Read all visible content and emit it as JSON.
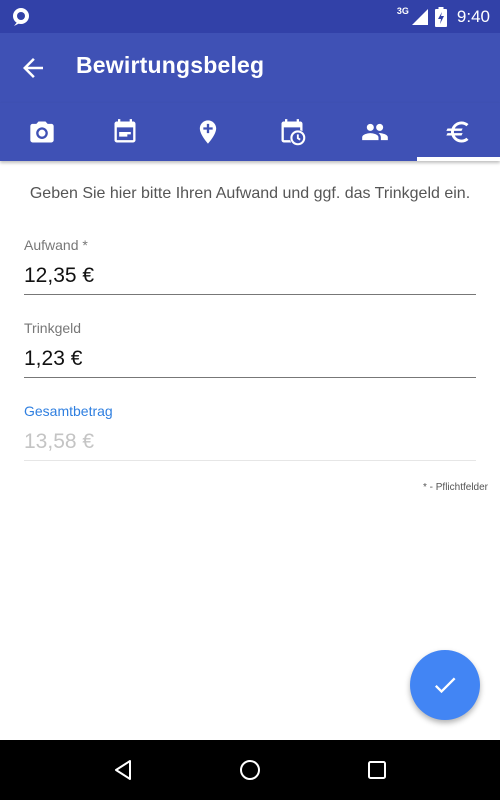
{
  "status_bar": {
    "network": "3G",
    "time": "9:40"
  },
  "app_bar": {
    "title": "Bewirtungsbeleg"
  },
  "tabs": [
    {
      "icon": "camera-icon"
    },
    {
      "icon": "calendar-icon"
    },
    {
      "icon": "add-location-icon"
    },
    {
      "icon": "schedule-calendar-icon"
    },
    {
      "icon": "people-icon"
    },
    {
      "icon": "euro-icon",
      "active": true
    }
  ],
  "form": {
    "instruction": "Geben Sie hier bitte Ihren Aufwand und ggf. das Trinkgeld ein.",
    "expense": {
      "label": "Aufwand *",
      "value": "12,35 €"
    },
    "tip": {
      "label": "Trinkgeld",
      "value": "1,23 €"
    },
    "total": {
      "label": "Gesamtbetrag",
      "value": "13,58 €"
    },
    "required_note": "* - Pflichtfelder"
  },
  "colors": {
    "primary": "#3f51b5",
    "primary_dark": "#3241a8",
    "accent": "#4285f4"
  }
}
